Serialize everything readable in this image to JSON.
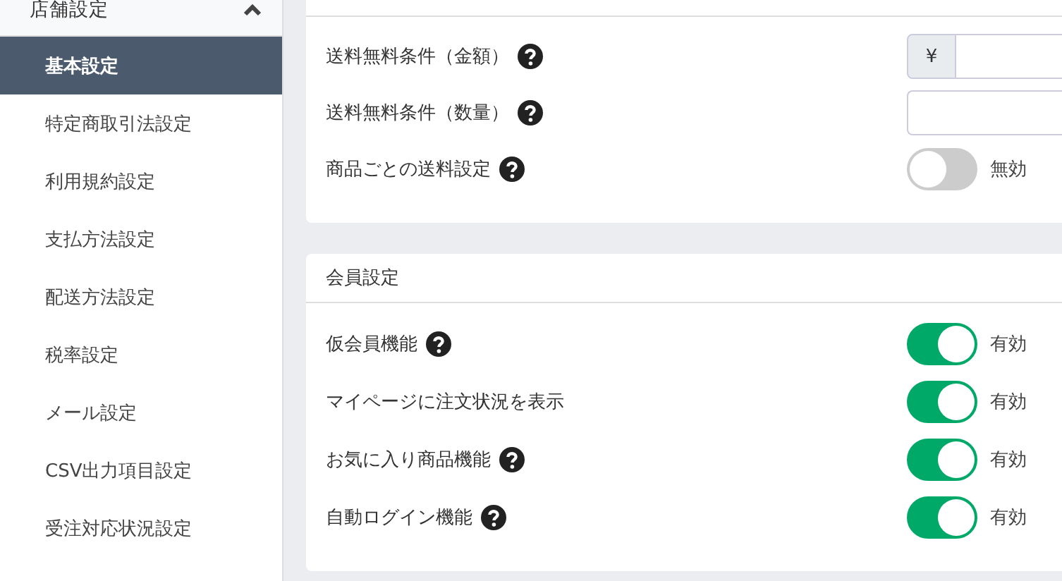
{
  "sidebar": {
    "group": {
      "label": "店舗設定",
      "expanded": true
    },
    "items": [
      {
        "label": "基本設定",
        "selected": true
      },
      {
        "label": "特定商取引法設定",
        "selected": false
      },
      {
        "label": "利用規約設定",
        "selected": false
      },
      {
        "label": "支払方法設定",
        "selected": false
      },
      {
        "label": "配送方法設定",
        "selected": false
      },
      {
        "label": "税率設定",
        "selected": false
      },
      {
        "label": "メール設定",
        "selected": false
      },
      {
        "label": "CSV出力項目設定",
        "selected": false
      },
      {
        "label": "受注対応状況設定",
        "selected": false
      }
    ]
  },
  "cards": [
    {
      "rows": [
        {
          "kind": "currency",
          "label": "送料無料条件（金額）",
          "help": true,
          "prefix": "¥"
        },
        {
          "kind": "text",
          "label": "送料無料条件（数量）",
          "help": true
        },
        {
          "kind": "toggle",
          "label": "商品ごとの送料設定",
          "help": true,
          "on": false,
          "state_label": "無効"
        }
      ]
    },
    {
      "title": "会員設定",
      "rows": [
        {
          "kind": "toggle",
          "label": "仮会員機能",
          "help": true,
          "on": true,
          "state_label": "有効"
        },
        {
          "kind": "toggle",
          "label": "マイページに注文状況を表示",
          "help": false,
          "on": true,
          "state_label": "有効"
        },
        {
          "kind": "toggle",
          "label": "お気に入り商品機能",
          "help": true,
          "on": true,
          "state_label": "有効"
        },
        {
          "kind": "toggle",
          "label": "自動ログイン機能",
          "help": true,
          "on": true,
          "state_label": "有効"
        }
      ]
    }
  ]
}
